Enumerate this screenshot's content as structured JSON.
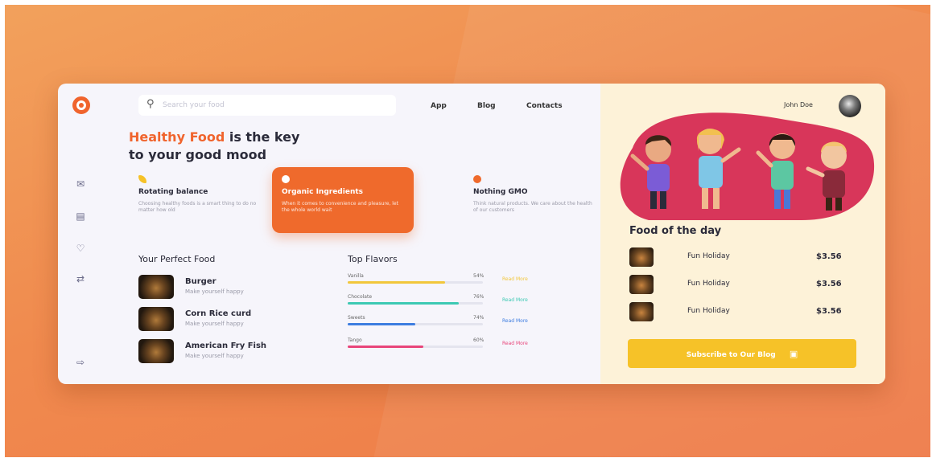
{
  "header": {
    "search_placeholder": "Search your food",
    "nav": [
      "App",
      "Blog",
      "Contacts"
    ],
    "user_name": "John Doe"
  },
  "hero": {
    "accent": "Healthy Food",
    "rest_line1": " is the key",
    "line2": "to your good mood"
  },
  "features": [
    {
      "title": "Rotating balance",
      "desc": "Choosing healthy foods is a smart thing to do no matter how old",
      "icon": "banana-icon",
      "color": "#f6c228"
    },
    {
      "title": "Organic Ingredients",
      "desc": "When it comes to convenience and pleasure, let the whole world wait",
      "icon": "apple-icon",
      "color": "#ffffff"
    },
    {
      "title": "Nothing GMO",
      "desc": "Think natural products. We care about the health of our customers",
      "icon": "tomato-icon",
      "color": "#ef6a2c"
    }
  ],
  "perfect_food": {
    "title": "Your Perfect Food",
    "items": [
      {
        "name": "Burger",
        "sub": "Make yourself happy"
      },
      {
        "name": "Corn Rice curd",
        "sub": "Make yourself happy"
      },
      {
        "name": "American Fry Fish",
        "sub": "Make yourself happy"
      }
    ]
  },
  "top_flavors": {
    "title": "Top Flavors",
    "items": [
      {
        "name": "Vanilla",
        "pct": "54%",
        "value": 0.72,
        "color": "#f2c73b",
        "link": "Read More"
      },
      {
        "name": "Chocolate",
        "pct": "76%",
        "value": 0.82,
        "color": "#3cc9b3",
        "link": "Read More"
      },
      {
        "name": "Sweets",
        "pct": "74%",
        "value": 0.5,
        "color": "#3d7de0",
        "link": "Read More"
      },
      {
        "name": "Tango",
        "pct": "60%",
        "value": 0.56,
        "color": "#e8457a",
        "link": "Read More"
      }
    ]
  },
  "food_of_day": {
    "title": "Food of the day",
    "items": [
      {
        "name": "Fun Holiday",
        "price": "$3.56"
      },
      {
        "name": "Fun Holiday",
        "price": "$3.56"
      },
      {
        "name": "Fun Holiday",
        "price": "$3.56"
      }
    ]
  },
  "subscribe_label": "Subscribe to Our Blog",
  "colors": {
    "accent": "#ef6a2c",
    "panel": "#fdf2d8",
    "cta": "#f6c228",
    "illustration": "#d8365a"
  }
}
